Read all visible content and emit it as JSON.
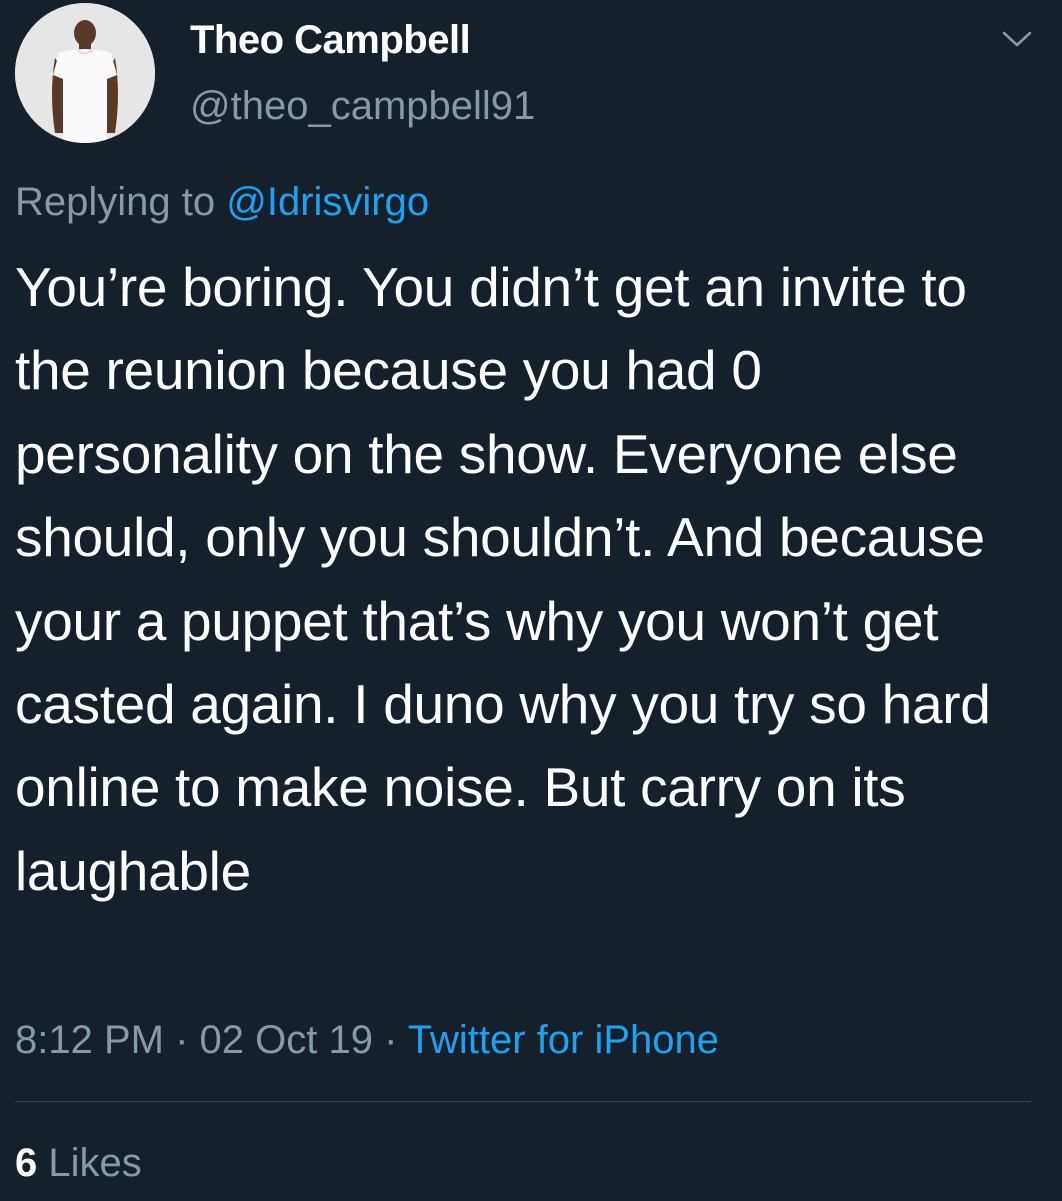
{
  "user": {
    "display_name": "Theo Campbell",
    "handle": "@theo_campbell91",
    "avatar_icon": "profile-photo-person-white-tshirt"
  },
  "reply": {
    "prefix": "Replying to ",
    "mention": "@Idrisvirgo"
  },
  "tweet": {
    "text": "You’re boring. You didn’t get an invite to the reunion because you had 0 personality on the show. Everyone else should, only you shouldn’t. And because your a puppet that’s why you won’t get casted again. I duno why you try so hard online to make noise. But carry on its laughable"
  },
  "meta": {
    "time": "8:12 PM",
    "separator": " · ",
    "date": "02 Oct 19",
    "source": "Twitter for iPhone"
  },
  "stats": {
    "likes_count": "6",
    "likes_label": " Likes"
  },
  "icons": {
    "menu": "chevron-down-icon"
  },
  "colors": {
    "background": "#15202b",
    "accent": "#1da1f2",
    "secondary_text": "#8899a6",
    "divider": "#38444d"
  }
}
